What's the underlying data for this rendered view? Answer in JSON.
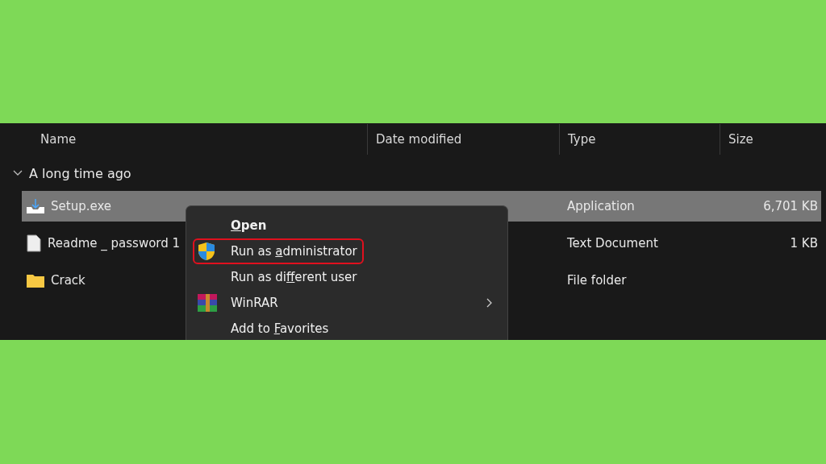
{
  "columns": [
    {
      "label": "Name"
    },
    {
      "label": "Date modified"
    },
    {
      "label": "Type"
    },
    {
      "label": "Size"
    }
  ],
  "group": {
    "label": "A long time ago",
    "expanded": true
  },
  "files": [
    {
      "name": "Setup.exe",
      "kind": "installer",
      "type": "Application",
      "size": "6,701 KB",
      "selected": true
    },
    {
      "name": "Readme _ password 1",
      "kind": "text",
      "type": "Text Document",
      "size": "1 KB",
      "selected": false
    },
    {
      "name": "Crack",
      "kind": "folder",
      "type": "File folder",
      "selected": false
    }
  ],
  "context_menu": [
    {
      "parts": [
        {
          "text": "O",
          "underlined": true
        },
        {
          "text": "pen"
        }
      ],
      "kind": "default",
      "highlighted": false,
      "submenu": false
    },
    {
      "parts": [
        {
          "text": "Run as "
        },
        {
          "text": "a",
          "underlined": true
        },
        {
          "text": "dministrator"
        }
      ],
      "kind": "shield",
      "highlighted": true,
      "submenu": false
    },
    {
      "parts": [
        {
          "text": "Run as di"
        },
        {
          "text": "f",
          "underlined": true
        },
        {
          "text": "ferent user"
        }
      ],
      "kind": "plain",
      "highlighted": false,
      "submenu": false
    },
    {
      "parts": [
        {
          "text": "WinRAR"
        }
      ],
      "kind": "archive",
      "highlighted": false,
      "submenu": true
    },
    {
      "parts": [
        {
          "text": "Add to "
        },
        {
          "text": "F",
          "underlined": true
        },
        {
          "text": "avorites"
        }
      ],
      "kind": "plain",
      "highlighted": false,
      "submenu": false
    }
  ]
}
